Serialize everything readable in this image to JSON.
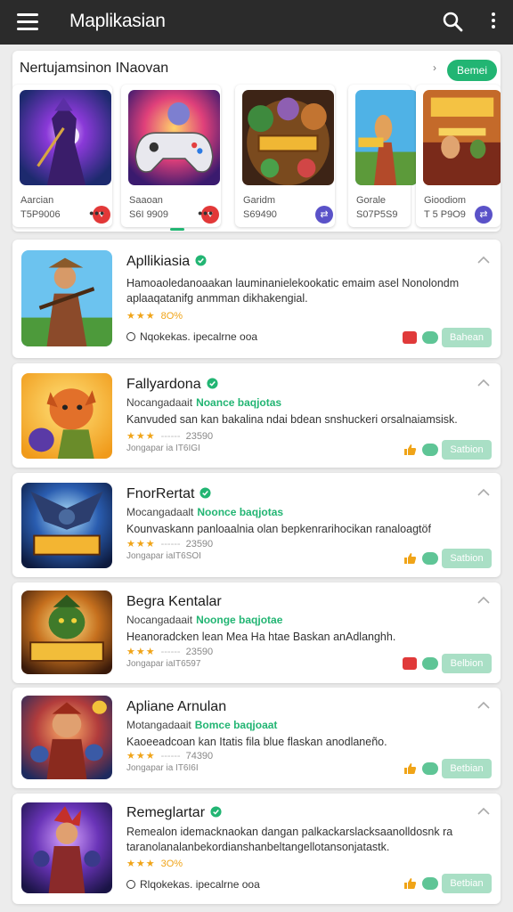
{
  "appbar": {
    "title": "Maplikasian",
    "icons": [
      "menu-icon",
      "search-icon",
      "more-vert-icon"
    ]
  },
  "colors": {
    "appbar": "#2b2b2b",
    "accent": "#22b573",
    "rating": "#f0a418",
    "disabled_button": "#a9dfc5"
  },
  "featured": {
    "title": "Nertujamsinon INaovan",
    "more_label": "Bemei",
    "cards": [
      {
        "name": "Aarcian",
        "meta": "T5P9006",
        "badge_icon": "heart-icon",
        "badge_color": "#e23838"
      },
      {
        "name": "Saaoan",
        "meta": "S6I 9909",
        "badge_icon": "heart-icon",
        "badge_color": "#e23838"
      },
      {
        "name": "Garidm",
        "meta": "S69490",
        "badge_icon": "arrows-icon",
        "badge_color": "#5a52c8"
      },
      {
        "name": "Gorale",
        "meta": "S07P5S9",
        "badge_icon": "",
        "badge_color": ""
      },
      {
        "name": "Gioodiom",
        "meta": "T 5 P9O9",
        "badge_icon": "arrows-icon",
        "badge_color": "#5a52c8"
      }
    ]
  },
  "items": [
    {
      "name": "Apllikiasia",
      "verified": true,
      "subtitle": "",
      "subtitle_tag": "",
      "desc": "Hamoaoledanoaakan lauminanielekookatic emaim asel Nonolondm aplaaqatanifg anmman dikhakengial.",
      "stars": "★★★",
      "rating_value": "8O%",
      "rating_count": "",
      "footer": "Nqokekas. ipecalrne ooa",
      "mini": "",
      "action_icon": "red",
      "button": "Bahean"
    },
    {
      "name": "Fallyardona",
      "verified": true,
      "subtitle": "Nocangadaait",
      "subtitle_tag": "Noance baqjotas",
      "desc": "Kanvuded san kan bakalina ndai bdean snshuckeri orsalnaiamsisk.",
      "stars": "★★★",
      "rating_value": "",
      "rating_count": "23590",
      "footer": "",
      "mini": "Jongapar ia IT6IGI",
      "action_icon": "warn",
      "button": "Satbion"
    },
    {
      "name": "FnorRertat",
      "verified": true,
      "subtitle": "Mocangadaalt",
      "subtitle_tag": "Noonce baqjotas",
      "desc": "Kounvaskann panloaalnia olan bepkenrarihocikan ranaloagtöf",
      "stars": "★★★",
      "rating_value": "",
      "rating_count": "23590",
      "footer": "",
      "mini": "Jongapar iaIT6SOI",
      "action_icon": "warn",
      "button": "Satbion"
    },
    {
      "name": "Begra Kentalar",
      "verified": false,
      "subtitle": "Nocangadaait",
      "subtitle_tag": "Noonge baqjotae",
      "desc": "Heanoradcken lean Mea Ha htae Baskan anAdlanghh.",
      "stars": "★★★",
      "rating_value": "",
      "rating_count": "23590",
      "footer": "",
      "mini": "Jongapar iaIT6597",
      "action_icon": "red",
      "button": "Belbion"
    },
    {
      "name": "Apliane Arnulan",
      "verified": false,
      "subtitle": "Motangadaait",
      "subtitle_tag": "Bomce baqjoaat",
      "desc": "Kaoeeadcoan kan Itatis fila blue flaskan anodlaneño.",
      "stars": "★★★",
      "rating_value": "",
      "rating_count": "74390",
      "footer": "",
      "mini": "Jongapar ia IT6I6I",
      "action_icon": "warn",
      "button": "Betbian"
    },
    {
      "name": "Remeglartar",
      "verified": true,
      "subtitle": "",
      "subtitle_tag": "",
      "desc": "Remealon idemacknaokan dangan palkackarslacksaanolldosnk ra taranolanalanbekordianshanbeltangellotansonjatastk.",
      "stars": "★★★",
      "rating_value": "3O%",
      "rating_count": "",
      "footer": "Rlqokekas. ipecalrne ooa",
      "mini": "",
      "action_icon": "warn",
      "button": "Betbian"
    }
  ]
}
